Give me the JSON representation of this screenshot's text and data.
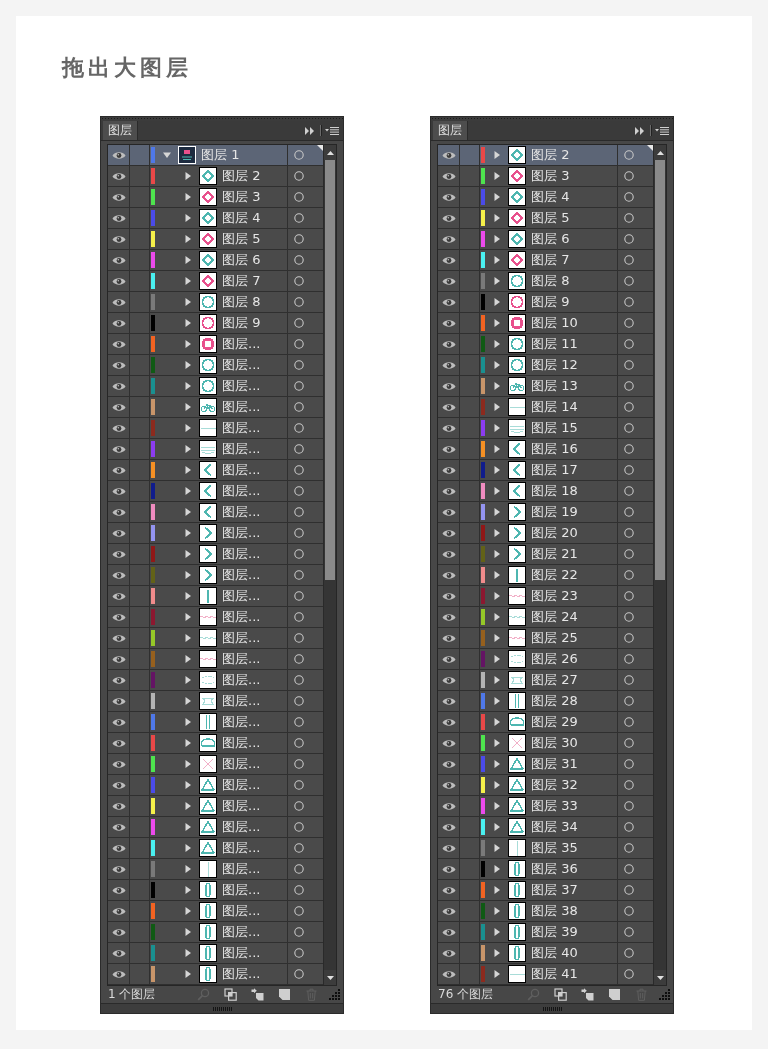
{
  "title": "拖出大图层",
  "panels": [
    {
      "tab": "图层",
      "layers": [
        {
          "name": "图层 1",
          "visible": true,
          "selected": true,
          "expanded": true,
          "color": "#4f78e8",
          "thumbnail": {
            "kind": "artwork",
            "color": "#e8508c"
          },
          "children": [
            {
              "name": "图层 2",
              "visible": true,
              "selected": false,
              "expanded": false,
              "color": "#e84848",
              "thumbnail": {
                "kind": "diamond",
                "color": "#4db6b0"
              }
            },
            {
              "name": "图层 3",
              "visible": true,
              "selected": false,
              "expanded": false,
              "color": "#4ee44e",
              "thumbnail": {
                "kind": "diamond",
                "color": "#e8508c"
              }
            },
            {
              "name": "图层 4",
              "visible": true,
              "selected": false,
              "expanded": false,
              "color": "#4b4be8",
              "thumbnail": {
                "kind": "diamond",
                "color": "#4db6b0"
              }
            },
            {
              "name": "图层 5",
              "visible": true,
              "selected": false,
              "expanded": false,
              "color": "#f5f04a",
              "thumbnail": {
                "kind": "diamond",
                "color": "#e8508c"
              }
            },
            {
              "name": "图层 6",
              "visible": true,
              "selected": false,
              "expanded": false,
              "color": "#ec4aec",
              "thumbnail": {
                "kind": "diamond",
                "color": "#4db6b0"
              }
            },
            {
              "name": "图层 7",
              "visible": true,
              "selected": false,
              "expanded": false,
              "color": "#4af0f0",
              "thumbnail": {
                "kind": "diamond",
                "color": "#e8508c"
              }
            },
            {
              "name": "图层 8",
              "visible": true,
              "selected": false,
              "expanded": false,
              "color": "#7a7a7a",
              "thumbnail": {
                "kind": "ring",
                "color": "#4db6b0"
              }
            },
            {
              "name": "图层 9",
              "visible": true,
              "selected": false,
              "expanded": false,
              "color": "#000000",
              "thumbnail": {
                "kind": "ring",
                "color": "#e8508c"
              }
            },
            {
              "name": "图层...",
              "visible": true,
              "selected": false,
              "expanded": false,
              "color": "#f26322",
              "thumbnail": {
                "kind": "donut",
                "color": "#e8508c"
              }
            },
            {
              "name": "图层...",
              "visible": true,
              "selected": false,
              "expanded": false,
              "color": "#0f5a14",
              "thumbnail": {
                "kind": "ring",
                "color": "#4db6b0"
              }
            },
            {
              "name": "图层...",
              "visible": true,
              "selected": false,
              "expanded": false,
              "color": "#1a9090",
              "thumbnail": {
                "kind": "ring",
                "color": "#4db6b0"
              }
            },
            {
              "name": "图层...",
              "visible": true,
              "selected": false,
              "expanded": false,
              "color": "#c8956a",
              "thumbnail": {
                "kind": "bicycle",
                "color": "#4db6b0"
              }
            },
            {
              "name": "图层...",
              "visible": true,
              "selected": false,
              "expanded": false,
              "color": "#8c2a1e",
              "thumbnail": {
                "kind": "rule",
                "color": "#a8dcd8"
              }
            },
            {
              "name": "图层...",
              "visible": true,
              "selected": false,
              "expanded": false,
              "color": "#8c3cf0",
              "thumbnail": {
                "kind": "lines",
                "color": "#a8dcd8"
              }
            },
            {
              "name": "图层...",
              "visible": true,
              "selected": false,
              "expanded": false,
              "color": "#f59024",
              "thumbnail": {
                "kind": "leftward",
                "color": "#4db6b0"
              }
            },
            {
              "name": "图层...",
              "visible": true,
              "selected": false,
              "expanded": false,
              "color": "#101c8c",
              "thumbnail": {
                "kind": "leftward",
                "color": "#4db6b0"
              }
            },
            {
              "name": "图层...",
              "visible": true,
              "selected": false,
              "expanded": false,
              "color": "#f08cc0",
              "thumbnail": {
                "kind": "leftward",
                "color": "#4db6b0"
              }
            },
            {
              "name": "图层...",
              "visible": true,
              "selected": false,
              "expanded": false,
              "color": "#9494f0",
              "thumbnail": {
                "kind": "rightward",
                "color": "#4db6b0"
              }
            },
            {
              "name": "图层...",
              "visible": true,
              "selected": false,
              "expanded": false,
              "color": "#901818",
              "thumbnail": {
                "kind": "rightward",
                "color": "#4db6b0"
              }
            },
            {
              "name": "图层...",
              "visible": true,
              "selected": false,
              "expanded": false,
              "color": "#626218",
              "thumbnail": {
                "kind": "rightward",
                "color": "#4db6b0"
              }
            },
            {
              "name": "图层...",
              "visible": true,
              "selected": false,
              "expanded": false,
              "color": "#f08c8c",
              "thumbnail": {
                "kind": "bar",
                "color": "#4db6b0"
              }
            },
            {
              "name": "图层...",
              "visible": true,
              "selected": false,
              "expanded": false,
              "color": "#8c1830",
              "thumbnail": {
                "kind": "wave",
                "color": "#f2b0c8"
              }
            },
            {
              "name": "图层...",
              "visible": true,
              "selected": false,
              "expanded": false,
              "color": "#96c828",
              "thumbnail": {
                "kind": "wave",
                "color": "#a8dcd8"
              }
            },
            {
              "name": "图层...",
              "visible": true,
              "selected": false,
              "expanded": false,
              "color": "#96601e",
              "thumbnail": {
                "kind": "wave",
                "color": "#f2b0c8"
              }
            },
            {
              "name": "图层...",
              "visible": true,
              "selected": false,
              "expanded": false,
              "color": "#641464",
              "thumbnail": {
                "kind": "dots",
                "color": "#a8dcd8"
              }
            },
            {
              "name": "图层...",
              "visible": true,
              "selected": false,
              "expanded": false,
              "color": "#b4b4b4",
              "thumbnail": {
                "kind": "band",
                "color": "#a8dcd8"
              }
            },
            {
              "name": "图层...",
              "visible": true,
              "selected": false,
              "expanded": false,
              "color": "#4f78e8",
              "thumbnail": {
                "kind": "columns",
                "color": "#4db6b0"
              }
            },
            {
              "name": "图层...",
              "visible": true,
              "selected": false,
              "expanded": false,
              "color": "#e84848",
              "thumbnail": {
                "kind": "arch",
                "color": "#4db6b0"
              }
            },
            {
              "name": "图层...",
              "visible": true,
              "selected": false,
              "expanded": false,
              "color": "#4ee44e",
              "thumbnail": {
                "kind": "cross",
                "color": "#f2b0c8"
              }
            },
            {
              "name": "图层...",
              "visible": true,
              "selected": false,
              "expanded": false,
              "color": "#4b4be8",
              "thumbnail": {
                "kind": "triangle",
                "color": "#4db6b0"
              }
            },
            {
              "name": "图层...",
              "visible": true,
              "selected": false,
              "expanded": false,
              "color": "#f5f04a",
              "thumbnail": {
                "kind": "triangle",
                "color": "#4db6b0"
              }
            },
            {
              "name": "图层...",
              "visible": true,
              "selected": false,
              "expanded": false,
              "color": "#ec4aec",
              "thumbnail": {
                "kind": "triangle",
                "color": "#4db6b0"
              }
            },
            {
              "name": "图层...",
              "visible": true,
              "selected": false,
              "expanded": false,
              "color": "#4af0f0",
              "thumbnail": {
                "kind": "triangle",
                "color": "#4db6b0"
              }
            },
            {
              "name": "图层...",
              "visible": true,
              "selected": false,
              "expanded": false,
              "color": "#7a7a7a",
              "thumbnail": {
                "kind": "stem",
                "color": "#a8dcd8"
              }
            },
            {
              "name": "图层...",
              "visible": true,
              "selected": false,
              "expanded": false,
              "color": "#000000",
              "thumbnail": {
                "kind": "capsule",
                "color": "#4db6b0"
              }
            },
            {
              "name": "图层...",
              "visible": true,
              "selected": false,
              "expanded": false,
              "color": "#f26322",
              "thumbnail": {
                "kind": "capsule",
                "color": "#4db6b0"
              }
            },
            {
              "name": "图层...",
              "visible": true,
              "selected": false,
              "expanded": false,
              "color": "#0f5a14",
              "thumbnail": {
                "kind": "capsule",
                "color": "#4db6b0"
              }
            },
            {
              "name": "图层...",
              "visible": true,
              "selected": false,
              "expanded": false,
              "color": "#1a9090",
              "thumbnail": {
                "kind": "capsule",
                "color": "#4db6b0"
              }
            },
            {
              "name": "图层...",
              "visible": true,
              "selected": false,
              "expanded": false,
              "color": "#c8956a",
              "thumbnail": {
                "kind": "capsule",
                "color": "#4db6b0"
              }
            }
          ]
        }
      ],
      "footer": {
        "count": "1 个图层",
        "tools": [
          {
            "kind": "search",
            "disabled": true
          },
          {
            "kind": "clip",
            "disabled": false
          },
          {
            "kind": "sublayer",
            "disabled": false
          },
          {
            "kind": "newlayer",
            "disabled": false
          },
          {
            "kind": "trash",
            "disabled": true
          }
        ]
      }
    },
    {
      "tab": "图层",
      "layers": [
        {
          "name": "图层 2",
          "visible": true,
          "selected": true,
          "expanded": false,
          "color": "#e84848",
          "thumbnail": {
            "kind": "diamond",
            "color": "#4db6b0"
          }
        },
        {
          "name": "图层 3",
          "visible": true,
          "selected": false,
          "expanded": false,
          "color": "#4ee44e",
          "thumbnail": {
            "kind": "diamond",
            "color": "#e8508c"
          }
        },
        {
          "name": "图层 4",
          "visible": true,
          "selected": false,
          "expanded": false,
          "color": "#4b4be8",
          "thumbnail": {
            "kind": "diamond",
            "color": "#4db6b0"
          }
        },
        {
          "name": "图层 5",
          "visible": true,
          "selected": false,
          "expanded": false,
          "color": "#f5f04a",
          "thumbnail": {
            "kind": "diamond",
            "color": "#e8508c"
          }
        },
        {
          "name": "图层 6",
          "visible": true,
          "selected": false,
          "expanded": false,
          "color": "#ec4aec",
          "thumbnail": {
            "kind": "diamond",
            "color": "#4db6b0"
          }
        },
        {
          "name": "图层 7",
          "visible": true,
          "selected": false,
          "expanded": false,
          "color": "#4af0f0",
          "thumbnail": {
            "kind": "diamond",
            "color": "#e8508c"
          }
        },
        {
          "name": "图层 8",
          "visible": true,
          "selected": false,
          "expanded": false,
          "color": "#7a7a7a",
          "thumbnail": {
            "kind": "ring",
            "color": "#4db6b0"
          }
        },
        {
          "name": "图层 9",
          "visible": true,
          "selected": false,
          "expanded": false,
          "color": "#000000",
          "thumbnail": {
            "kind": "ring",
            "color": "#e8508c"
          }
        },
        {
          "name": "图层 10",
          "visible": true,
          "selected": false,
          "expanded": false,
          "color": "#f26322",
          "thumbnail": {
            "kind": "donut",
            "color": "#e8508c"
          }
        },
        {
          "name": "图层 11",
          "visible": true,
          "selected": false,
          "expanded": false,
          "color": "#0f5a14",
          "thumbnail": {
            "kind": "ring",
            "color": "#4db6b0"
          }
        },
        {
          "name": "图层 12",
          "visible": true,
          "selected": false,
          "expanded": false,
          "color": "#1a9090",
          "thumbnail": {
            "kind": "ring",
            "color": "#4db6b0"
          }
        },
        {
          "name": "图层 13",
          "visible": true,
          "selected": false,
          "expanded": false,
          "color": "#c8956a",
          "thumbnail": {
            "kind": "bicycle",
            "color": "#4db6b0"
          }
        },
        {
          "name": "图层 14",
          "visible": true,
          "selected": false,
          "expanded": false,
          "color": "#8c2a1e",
          "thumbnail": {
            "kind": "rule",
            "color": "#a8dcd8"
          }
        },
        {
          "name": "图层 15",
          "visible": true,
          "selected": false,
          "expanded": false,
          "color": "#8c3cf0",
          "thumbnail": {
            "kind": "lines",
            "color": "#a8dcd8"
          }
        },
        {
          "name": "图层 16",
          "visible": true,
          "selected": false,
          "expanded": false,
          "color": "#f59024",
          "thumbnail": {
            "kind": "leftward",
            "color": "#4db6b0"
          }
        },
        {
          "name": "图层 17",
          "visible": true,
          "selected": false,
          "expanded": false,
          "color": "#101c8c",
          "thumbnail": {
            "kind": "leftward",
            "color": "#4db6b0"
          }
        },
        {
          "name": "图层 18",
          "visible": true,
          "selected": false,
          "expanded": false,
          "color": "#f08cc0",
          "thumbnail": {
            "kind": "leftward",
            "color": "#4db6b0"
          }
        },
        {
          "name": "图层 19",
          "visible": true,
          "selected": false,
          "expanded": false,
          "color": "#9494f0",
          "thumbnail": {
            "kind": "rightward",
            "color": "#4db6b0"
          }
        },
        {
          "name": "图层 20",
          "visible": true,
          "selected": false,
          "expanded": false,
          "color": "#901818",
          "thumbnail": {
            "kind": "rightward",
            "color": "#4db6b0"
          }
        },
        {
          "name": "图层 21",
          "visible": true,
          "selected": false,
          "expanded": false,
          "color": "#626218",
          "thumbnail": {
            "kind": "rightward",
            "color": "#4db6b0"
          }
        },
        {
          "name": "图层 22",
          "visible": true,
          "selected": false,
          "expanded": false,
          "color": "#f08c8c",
          "thumbnail": {
            "kind": "bar",
            "color": "#4db6b0"
          }
        },
        {
          "name": "图层 23",
          "visible": true,
          "selected": false,
          "expanded": false,
          "color": "#8c1830",
          "thumbnail": {
            "kind": "wave",
            "color": "#f2b0c8"
          }
        },
        {
          "name": "图层 24",
          "visible": true,
          "selected": false,
          "expanded": false,
          "color": "#96c828",
          "thumbnail": {
            "kind": "wave",
            "color": "#a8dcd8"
          }
        },
        {
          "name": "图层 25",
          "visible": true,
          "selected": false,
          "expanded": false,
          "color": "#96601e",
          "thumbnail": {
            "kind": "wave",
            "color": "#f2b0c8"
          }
        },
        {
          "name": "图层 26",
          "visible": true,
          "selected": false,
          "expanded": false,
          "color": "#641464",
          "thumbnail": {
            "kind": "dots",
            "color": "#a8dcd8"
          }
        },
        {
          "name": "图层 27",
          "visible": true,
          "selected": false,
          "expanded": false,
          "color": "#b4b4b4",
          "thumbnail": {
            "kind": "band",
            "color": "#a8dcd8"
          }
        },
        {
          "name": "图层 28",
          "visible": true,
          "selected": false,
          "expanded": false,
          "color": "#4f78e8",
          "thumbnail": {
            "kind": "columns",
            "color": "#4db6b0"
          }
        },
        {
          "name": "图层 29",
          "visible": true,
          "selected": false,
          "expanded": false,
          "color": "#e84848",
          "thumbnail": {
            "kind": "arch",
            "color": "#4db6b0"
          }
        },
        {
          "name": "图层 30",
          "visible": true,
          "selected": false,
          "expanded": false,
          "color": "#4ee44e",
          "thumbnail": {
            "kind": "cross",
            "color": "#f2b0c8"
          }
        },
        {
          "name": "图层 31",
          "visible": true,
          "selected": false,
          "expanded": false,
          "color": "#4b4be8",
          "thumbnail": {
            "kind": "triangle",
            "color": "#4db6b0"
          }
        },
        {
          "name": "图层 32",
          "visible": true,
          "selected": false,
          "expanded": false,
          "color": "#f5f04a",
          "thumbnail": {
            "kind": "triangle",
            "color": "#4db6b0"
          }
        },
        {
          "name": "图层 33",
          "visible": true,
          "selected": false,
          "expanded": false,
          "color": "#ec4aec",
          "thumbnail": {
            "kind": "triangle",
            "color": "#4db6b0"
          }
        },
        {
          "name": "图层 34",
          "visible": true,
          "selected": false,
          "expanded": false,
          "color": "#4af0f0",
          "thumbnail": {
            "kind": "triangle",
            "color": "#4db6b0"
          }
        },
        {
          "name": "图层 35",
          "visible": true,
          "selected": false,
          "expanded": false,
          "color": "#7a7a7a",
          "thumbnail": {
            "kind": "stem",
            "color": "#a8dcd8"
          }
        },
        {
          "name": "图层 36",
          "visible": true,
          "selected": false,
          "expanded": false,
          "color": "#000000",
          "thumbnail": {
            "kind": "capsule",
            "color": "#4db6b0"
          }
        },
        {
          "name": "图层 37",
          "visible": true,
          "selected": false,
          "expanded": false,
          "color": "#f26322",
          "thumbnail": {
            "kind": "capsule",
            "color": "#4db6b0"
          }
        },
        {
          "name": "图层 38",
          "visible": true,
          "selected": false,
          "expanded": false,
          "color": "#0f5a14",
          "thumbnail": {
            "kind": "capsule",
            "color": "#4db6b0"
          }
        },
        {
          "name": "图层 39",
          "visible": true,
          "selected": false,
          "expanded": false,
          "color": "#1a9090",
          "thumbnail": {
            "kind": "capsule",
            "color": "#4db6b0"
          }
        },
        {
          "name": "图层 40",
          "visible": true,
          "selected": false,
          "expanded": false,
          "color": "#c8956a",
          "thumbnail": {
            "kind": "capsule",
            "color": "#4db6b0"
          }
        },
        {
          "name": "图层 41",
          "visible": true,
          "selected": false,
          "expanded": false,
          "color": "#8c2a1e",
          "thumbnail": {
            "kind": "rule",
            "color": "#a8dcd8"
          }
        }
      ],
      "footer": {
        "count": "76 个图层",
        "tools": [
          {
            "kind": "search",
            "disabled": true
          },
          {
            "kind": "clip",
            "disabled": false
          },
          {
            "kind": "sublayer",
            "disabled": false
          },
          {
            "kind": "newlayer",
            "disabled": false
          },
          {
            "kind": "trash",
            "disabled": true
          }
        ]
      }
    }
  ]
}
